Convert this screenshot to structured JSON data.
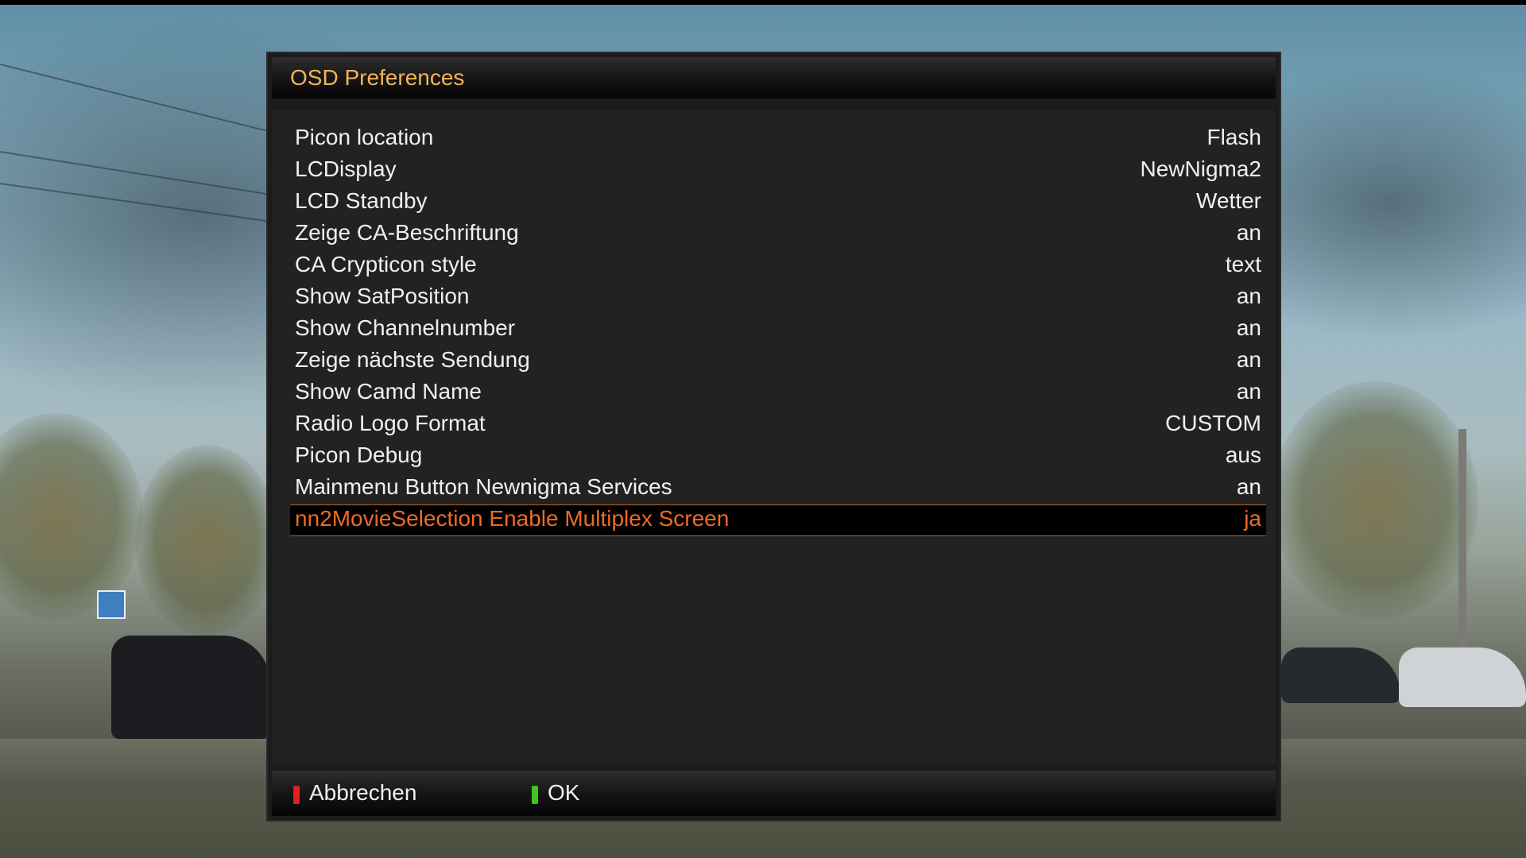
{
  "dialog": {
    "title": "OSD Preferences"
  },
  "settings": [
    {
      "label": "Picon location",
      "value": "Flash"
    },
    {
      "label": "LCDisplay",
      "value": "NewNigma2"
    },
    {
      "label": "LCD Standby",
      "value": "Wetter"
    },
    {
      "label": "Zeige CA-Beschriftung",
      "value": "an"
    },
    {
      "label": "CA Crypticon style",
      "value": "text"
    },
    {
      "label": "Show SatPosition",
      "value": "an"
    },
    {
      "label": "Show Channelnumber",
      "value": "an"
    },
    {
      "label": "Zeige nächste Sendung",
      "value": "an"
    },
    {
      "label": "Show Camd Name",
      "value": "an"
    },
    {
      "label": "Radio Logo Format",
      "value": "CUSTOM"
    },
    {
      "label": "Picon Debug",
      "value": "aus"
    },
    {
      "label": "Mainmenu Button Newnigma Services",
      "value": "an"
    },
    {
      "label": "nn2MovieSelection Enable Multiplex Screen",
      "value": "ja",
      "selected": true
    }
  ],
  "buttons": {
    "cancel": {
      "label": "Abbrechen",
      "color": "#e02020",
      "icon": "red-key-icon"
    },
    "ok": {
      "label": "OK",
      "color": "#3cc81e",
      "icon": "green-key-icon"
    }
  },
  "colors": {
    "title": "#f2b35b",
    "selected_text": "#ee6a22",
    "selected_border": "#b8651f",
    "text": "#f0f0f0",
    "panel": "#222222"
  }
}
